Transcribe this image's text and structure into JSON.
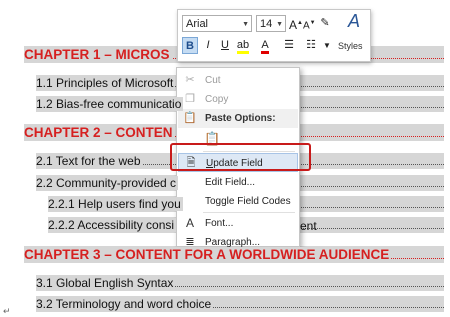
{
  "document": {
    "chapter1": "CHAPTER 1 – MICROS",
    "item_1_1": "1.1 Principles of Microsoft",
    "item_1_2": "1.2 Bias-free communicatio",
    "chapter2": "CHAPTER 2 – CONTEN",
    "item_2_1": "2.1 Text for the web",
    "item_2_2": "2.2 Community-provided c",
    "item_2_2_1": "2.2.1 Help users find you",
    "item_2_2_2": "2.2.2 Accessibility consi",
    "item_2_2_2_tail": "ent",
    "chapter3": "CHAPTER 3 – CONTENT FOR A WORLDWIDE AUDIENCE",
    "item_3_1": "3.1 Global English Syntax",
    "item_3_2": "3.2 Terminology and word choice"
  },
  "mini_toolbar": {
    "font_name": "Arial",
    "font_size": "14",
    "grow_font": "A",
    "shrink_font": "A",
    "bold": "B",
    "italic": "I",
    "underline": "U",
    "font_color": "A",
    "styles_label": "Styles"
  },
  "context_menu": {
    "cut": "Cut",
    "copy": "Copy",
    "paste_options": "Paste Options:",
    "update_field": "Update Field",
    "edit_field": "Edit Field...",
    "toggle_codes": "Toggle Field Codes",
    "font": "Font...",
    "paragraph": "Paragraph...",
    "font_icon_letter": "A"
  },
  "colors": {
    "chapter_red": "#d62020",
    "highlight_box": "#c81a1a",
    "menu_hover": "#dde8f5",
    "field_shading": "#d6d6d6"
  }
}
